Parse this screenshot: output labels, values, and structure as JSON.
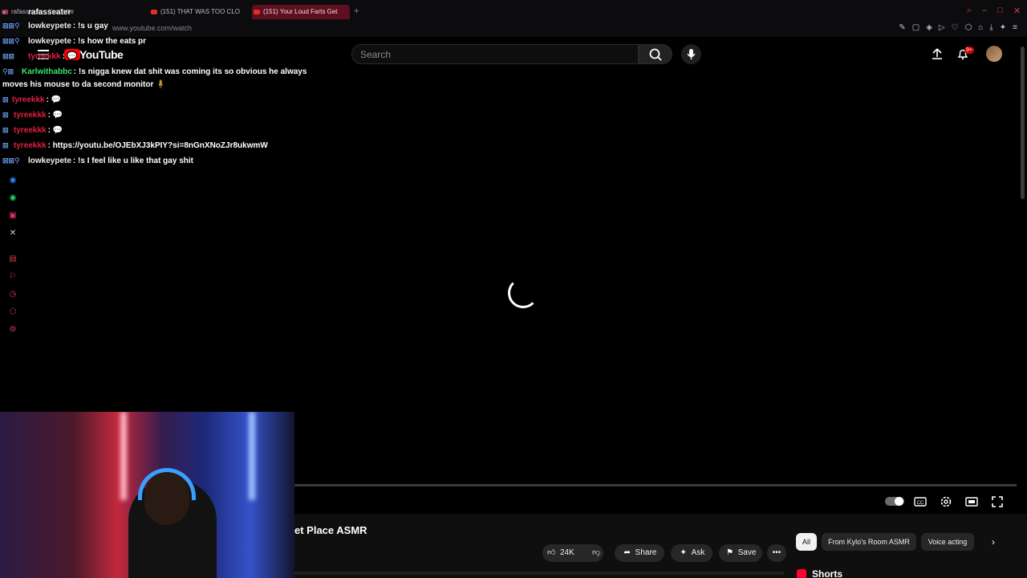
{
  "browser": {
    "tabs": [
      {
        "label": "rafasseater : YouTube"
      },
      {
        "label": "(151) THAT WAS TOO CLO"
      },
      {
        "label": "(151) Your Loud Farts Get"
      }
    ],
    "new_tab": "+",
    "url": "www.youtube.com/watch",
    "window_controls": [
      "✕",
      "–",
      "□",
      "✕"
    ]
  },
  "youtube": {
    "logo_text": "YouTube",
    "search_placeholder": "Search",
    "notification_count": "9+"
  },
  "chat": {
    "colors": {
      "lowkeypete": "#e8e8e8",
      "tyreekkk": "#e0213e",
      "karl": "#39e86a",
      "rafasseater": "#ffffff"
    },
    "messages": [
      {
        "user": "rafasseater",
        "text": "",
        "top": 0
      },
      {
        "user": "lowkeypete",
        "text": ": !s u gay"
      },
      {
        "user": "lowkeypete",
        "text": ": !s how the eats pr"
      },
      {
        "user": "tyreekkk",
        "text": ": 💬"
      },
      {
        "user": "Karlwithabbc",
        "text": ": !s nigga knew dat shit was coming its so obvious he always"
      },
      {
        "user": "",
        "text": "moves his mouse to da second monitor 🧍"
      },
      {
        "user": "tyreekkk",
        "text": ": 💬"
      },
      {
        "user": "tyreekkk",
        "text": ": 💬"
      },
      {
        "user": "tyreekkk",
        "text": ": 💬"
      },
      {
        "user": "tyreekkk",
        "text": ": https://youtu.be/OJEbXJ3kPIY?si=8nGnXNoZJr8ukwmW"
      },
      {
        "user": "lowkeypete",
        "text": ": !s I feel like u like that gay shit"
      }
    ]
  },
  "video": {
    "title_partial": "et Place ASMR",
    "likes": "24K",
    "share_label": "Share",
    "ask_label": "Ask",
    "save_label": "Save",
    "more_label": "•••"
  },
  "related": {
    "chips": [
      "All",
      "From Kylo's Room ASMR",
      "Voice acting"
    ],
    "shorts_label": "Shorts"
  }
}
